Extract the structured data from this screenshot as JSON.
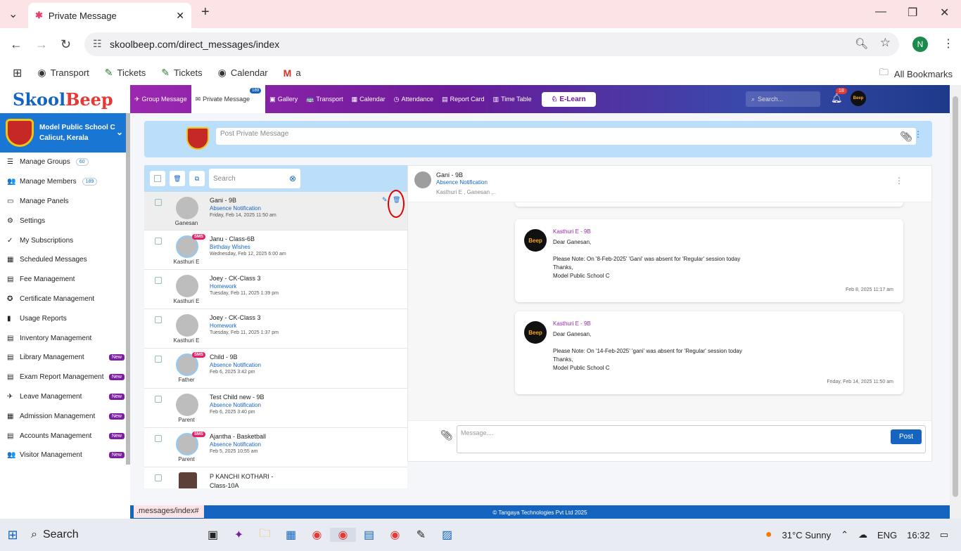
{
  "browser": {
    "tab_title": "Private Message",
    "url": "skoolbeep.com/direct_messages/index",
    "profile_initial": "N",
    "bookmarks": [
      "Transport",
      "Tickets",
      "Tickets",
      "Calendar",
      "a"
    ],
    "all_bookmarks": "All Bookmarks",
    "status_url": ".messages/index#"
  },
  "app": {
    "logo_left": "Skool",
    "logo_right": "Beep",
    "nav": [
      {
        "label": "Group Message",
        "icon": "✈"
      },
      {
        "label": "Private Message",
        "icon": "✉",
        "badge": "189"
      },
      {
        "label": "Gallery",
        "icon": "▣"
      },
      {
        "label": "Transport",
        "icon": "🚌"
      },
      {
        "label": "Calendar",
        "icon": "▦"
      },
      {
        "label": "Attendance",
        "icon": "◷"
      },
      {
        "label": "Report Card",
        "icon": "▤"
      },
      {
        "label": "Time Table",
        "icon": "▥"
      }
    ],
    "elearn": "E-Learn",
    "search_placeholder": "Search...",
    "notifications": "18",
    "user_avatar": "Beep"
  },
  "sidebar": {
    "school_name": "Model Public School C",
    "school_location": "Calicut, Kerala",
    "items": [
      {
        "label": "Manage Groups",
        "icon": "☰",
        "count": "60"
      },
      {
        "label": "Manage Members",
        "icon": "👥",
        "count": "189"
      },
      {
        "label": "Manage Panels",
        "icon": "▭"
      },
      {
        "label": "Settings",
        "icon": "⚙"
      },
      {
        "label": "My Subscriptions",
        "icon": "✓"
      },
      {
        "label": "Scheduled Messages",
        "icon": "▦"
      },
      {
        "label": "Fee Management",
        "icon": "▤"
      },
      {
        "label": "Certificate Management",
        "icon": "✪"
      },
      {
        "label": "Usage Reports",
        "icon": "▮"
      },
      {
        "label": "Inventory Management",
        "icon": "▤"
      },
      {
        "label": "Library Management",
        "icon": "▤",
        "new": "New"
      },
      {
        "label": "Exam Report Management",
        "icon": "▤",
        "new": "New"
      },
      {
        "label": "Leave Management",
        "icon": "✈",
        "new": "New"
      },
      {
        "label": "Admission Management",
        "icon": "▦",
        "new": "New"
      },
      {
        "label": "Accounts Management",
        "icon": "▤",
        "new": "New"
      },
      {
        "label": "Visitor Management",
        "icon": "👥",
        "new": "New"
      }
    ]
  },
  "post": {
    "placeholder": "Post Private Message"
  },
  "list": {
    "search_placeholder": "Search",
    "rows": [
      {
        "name": "Gani - 9B",
        "subject": "Absence Notification",
        "date": "Friday, Feb 14, 2025 11:50 am",
        "avatar_label": "Ganesan",
        "sms": false
      },
      {
        "name": "Janu - Class-6B",
        "subject": "Birthday Wishes",
        "date": "Wednesday, Feb 12, 2025 6:00 am",
        "avatar_label": "Kasthuri E",
        "sms": true
      },
      {
        "name": "Joey - CK-Class 3",
        "subject": "Homework",
        "date": "Tuesday, Feb 11, 2025 1:39 pm",
        "avatar_label": "Kasthuri E",
        "sms": false
      },
      {
        "name": "Joey - CK-Class 3",
        "subject": "Homework",
        "date": "Tuesday, Feb 11, 2025 1:37 pm",
        "avatar_label": "Kasthuri E",
        "sms": false
      },
      {
        "name": "Child - 9B",
        "subject": "Absence Notification",
        "date": "Feb 6, 2025 3:42 pm",
        "avatar_label": "Father",
        "sms": true
      },
      {
        "name": "Test Child new - 9B",
        "subject": "Absence Notification",
        "date": "Feb 6, 2025 3:40 pm",
        "avatar_label": "Parent",
        "sms": false
      },
      {
        "name": "Ajantha - Basketball",
        "subject": "Absence Notification",
        "date": "Feb 5, 2025 10:55 am",
        "avatar_label": "Parent",
        "sms": true
      },
      {
        "name": "P KANCHI KOTHARI - Class-10A",
        "subject": "",
        "date": "",
        "avatar_label": "",
        "sms": false
      }
    ],
    "sms_label": "SMS"
  },
  "chat": {
    "name": "Gani - 9B",
    "subject": "Absence Notification",
    "people": "Kasthuri E , Ganesan ,..",
    "messages": [
      {
        "sender": "Kasthuri E - 9B",
        "greeting": "Dear Ganesan,",
        "body": "Please Note: On '8-Feb-2025' 'Gani' was absent for 'Regular' session today",
        "thanks": "Thanks,",
        "sign": "Model Public School C",
        "date": "Feb 8, 2025 11:17 am"
      },
      {
        "sender": "Kasthuri E - 9B",
        "greeting": "Dear Ganesan,",
        "body": "Please Note: On '14-Feb-2025' 'gani' was absent for 'Regular' session today",
        "thanks": "Thanks,",
        "sign": "Model Public School C",
        "date": "Friday, Feb 14, 2025 11:50 am"
      }
    ],
    "composer_placeholder": "Message....",
    "post_label": "Post"
  },
  "footer": "© Tangaya Technologies Pvt Ltd 2025",
  "taskbar": {
    "search": "Search",
    "weather": "31°C  Sunny",
    "lang": "ENG",
    "time": "16:32"
  }
}
